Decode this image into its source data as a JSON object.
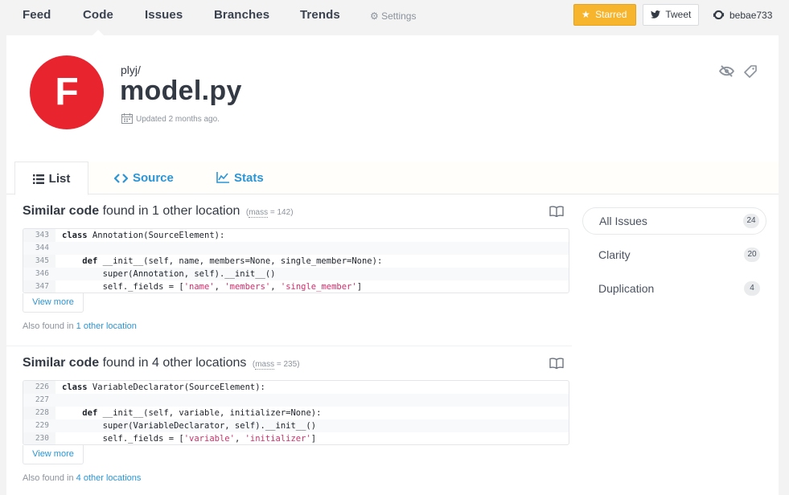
{
  "nav": {
    "items": [
      "Feed",
      "Code",
      "Issues",
      "Branches",
      "Trends"
    ],
    "settings_label": "Settings",
    "starred_label": "Starred",
    "tweet_label": "Tweet",
    "username": "bebae733"
  },
  "header": {
    "avatar_letter": "F",
    "repo_owner": "plyj/",
    "file_name": "model.py",
    "updated_text": "Updated 2 months ago."
  },
  "tabs": [
    {
      "label": "List",
      "icon": "list-icon"
    },
    {
      "label": "Source",
      "icon": "code-icon"
    },
    {
      "label": "Stats",
      "icon": "stats-icon"
    }
  ],
  "issues": [
    {
      "title_bold": "Similar code",
      "title_rest": " found in 1 other location",
      "mass_label": "mass",
      "mass_value": "= 142",
      "lines": [
        {
          "num": "343",
          "code": "class Annotation(SourceElement):"
        },
        {
          "num": "344",
          "code": ""
        },
        {
          "num": "345",
          "code": "    def __init__(self, name, members=None, single_member=None):"
        },
        {
          "num": "346",
          "code": "        super(Annotation, self).__init__()"
        },
        {
          "num": "347",
          "code": "        self._fields = ['name', 'members', 'single_member']"
        }
      ],
      "view_more": "View more",
      "also_prefix": "Also found in ",
      "also_link": "1 other location"
    },
    {
      "title_bold": "Similar code",
      "title_rest": " found in 4 other locations",
      "mass_label": "mass",
      "mass_value": "= 235",
      "lines": [
        {
          "num": "226",
          "code": "class VariableDeclarator(SourceElement):"
        },
        {
          "num": "227",
          "code": ""
        },
        {
          "num": "228",
          "code": "    def __init__(self, variable, initializer=None):"
        },
        {
          "num": "229",
          "code": "        super(VariableDeclarator, self).__init__()"
        },
        {
          "num": "230",
          "code": "        self._fields = ['variable', 'initializer']"
        }
      ],
      "view_more": "View more",
      "also_prefix": "Also found in ",
      "also_link": "4 other locations"
    }
  ],
  "sidebar": [
    {
      "label": "All Issues",
      "count": "24"
    },
    {
      "label": "Clarity",
      "count": "20"
    },
    {
      "label": "Duplication",
      "count": "4"
    }
  ],
  "colors": {
    "accent": "#2b95d6",
    "avatar": "#e8242f",
    "starred": "#f7b52e",
    "string": "#d12f6b"
  }
}
